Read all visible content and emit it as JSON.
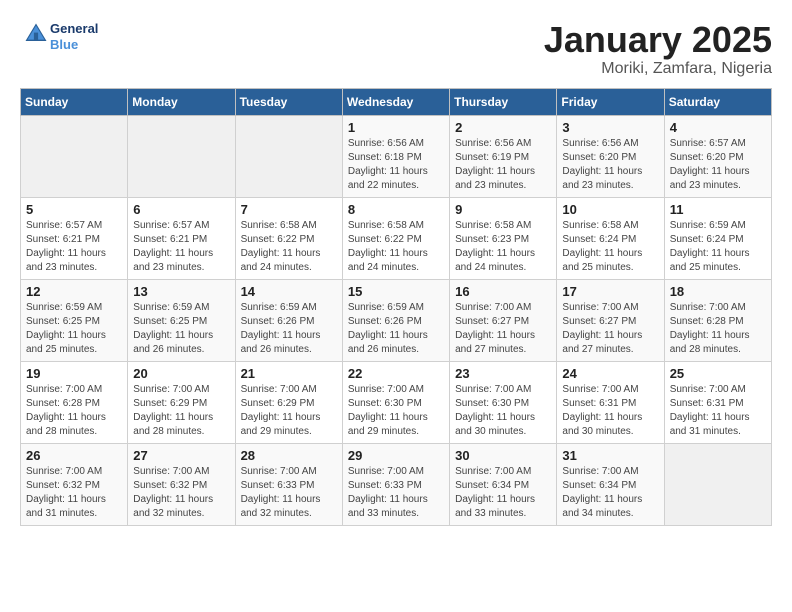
{
  "header": {
    "logo_general": "General",
    "logo_blue": "Blue",
    "title": "January 2025",
    "subtitle": "Moriki, Zamfara, Nigeria"
  },
  "weekdays": [
    "Sunday",
    "Monday",
    "Tuesday",
    "Wednesday",
    "Thursday",
    "Friday",
    "Saturday"
  ],
  "weeks": [
    [
      {
        "day": "",
        "sunrise": "",
        "sunset": "",
        "daylight": ""
      },
      {
        "day": "",
        "sunrise": "",
        "sunset": "",
        "daylight": ""
      },
      {
        "day": "",
        "sunrise": "",
        "sunset": "",
        "daylight": ""
      },
      {
        "day": "1",
        "sunrise": "Sunrise: 6:56 AM",
        "sunset": "Sunset: 6:18 PM",
        "daylight": "Daylight: 11 hours and 22 minutes."
      },
      {
        "day": "2",
        "sunrise": "Sunrise: 6:56 AM",
        "sunset": "Sunset: 6:19 PM",
        "daylight": "Daylight: 11 hours and 23 minutes."
      },
      {
        "day": "3",
        "sunrise": "Sunrise: 6:56 AM",
        "sunset": "Sunset: 6:20 PM",
        "daylight": "Daylight: 11 hours and 23 minutes."
      },
      {
        "day": "4",
        "sunrise": "Sunrise: 6:57 AM",
        "sunset": "Sunset: 6:20 PM",
        "daylight": "Daylight: 11 hours and 23 minutes."
      }
    ],
    [
      {
        "day": "5",
        "sunrise": "Sunrise: 6:57 AM",
        "sunset": "Sunset: 6:21 PM",
        "daylight": "Daylight: 11 hours and 23 minutes."
      },
      {
        "day": "6",
        "sunrise": "Sunrise: 6:57 AM",
        "sunset": "Sunset: 6:21 PM",
        "daylight": "Daylight: 11 hours and 23 minutes."
      },
      {
        "day": "7",
        "sunrise": "Sunrise: 6:58 AM",
        "sunset": "Sunset: 6:22 PM",
        "daylight": "Daylight: 11 hours and 24 minutes."
      },
      {
        "day": "8",
        "sunrise": "Sunrise: 6:58 AM",
        "sunset": "Sunset: 6:22 PM",
        "daylight": "Daylight: 11 hours and 24 minutes."
      },
      {
        "day": "9",
        "sunrise": "Sunrise: 6:58 AM",
        "sunset": "Sunset: 6:23 PM",
        "daylight": "Daylight: 11 hours and 24 minutes."
      },
      {
        "day": "10",
        "sunrise": "Sunrise: 6:58 AM",
        "sunset": "Sunset: 6:24 PM",
        "daylight": "Daylight: 11 hours and 25 minutes."
      },
      {
        "day": "11",
        "sunrise": "Sunrise: 6:59 AM",
        "sunset": "Sunset: 6:24 PM",
        "daylight": "Daylight: 11 hours and 25 minutes."
      }
    ],
    [
      {
        "day": "12",
        "sunrise": "Sunrise: 6:59 AM",
        "sunset": "Sunset: 6:25 PM",
        "daylight": "Daylight: 11 hours and 25 minutes."
      },
      {
        "day": "13",
        "sunrise": "Sunrise: 6:59 AM",
        "sunset": "Sunset: 6:25 PM",
        "daylight": "Daylight: 11 hours and 26 minutes."
      },
      {
        "day": "14",
        "sunrise": "Sunrise: 6:59 AM",
        "sunset": "Sunset: 6:26 PM",
        "daylight": "Daylight: 11 hours and 26 minutes."
      },
      {
        "day": "15",
        "sunrise": "Sunrise: 6:59 AM",
        "sunset": "Sunset: 6:26 PM",
        "daylight": "Daylight: 11 hours and 26 minutes."
      },
      {
        "day": "16",
        "sunrise": "Sunrise: 7:00 AM",
        "sunset": "Sunset: 6:27 PM",
        "daylight": "Daylight: 11 hours and 27 minutes."
      },
      {
        "day": "17",
        "sunrise": "Sunrise: 7:00 AM",
        "sunset": "Sunset: 6:27 PM",
        "daylight": "Daylight: 11 hours and 27 minutes."
      },
      {
        "day": "18",
        "sunrise": "Sunrise: 7:00 AM",
        "sunset": "Sunset: 6:28 PM",
        "daylight": "Daylight: 11 hours and 28 minutes."
      }
    ],
    [
      {
        "day": "19",
        "sunrise": "Sunrise: 7:00 AM",
        "sunset": "Sunset: 6:28 PM",
        "daylight": "Daylight: 11 hours and 28 minutes."
      },
      {
        "day": "20",
        "sunrise": "Sunrise: 7:00 AM",
        "sunset": "Sunset: 6:29 PM",
        "daylight": "Daylight: 11 hours and 28 minutes."
      },
      {
        "day": "21",
        "sunrise": "Sunrise: 7:00 AM",
        "sunset": "Sunset: 6:29 PM",
        "daylight": "Daylight: 11 hours and 29 minutes."
      },
      {
        "day": "22",
        "sunrise": "Sunrise: 7:00 AM",
        "sunset": "Sunset: 6:30 PM",
        "daylight": "Daylight: 11 hours and 29 minutes."
      },
      {
        "day": "23",
        "sunrise": "Sunrise: 7:00 AM",
        "sunset": "Sunset: 6:30 PM",
        "daylight": "Daylight: 11 hours and 30 minutes."
      },
      {
        "day": "24",
        "sunrise": "Sunrise: 7:00 AM",
        "sunset": "Sunset: 6:31 PM",
        "daylight": "Daylight: 11 hours and 30 minutes."
      },
      {
        "day": "25",
        "sunrise": "Sunrise: 7:00 AM",
        "sunset": "Sunset: 6:31 PM",
        "daylight": "Daylight: 11 hours and 31 minutes."
      }
    ],
    [
      {
        "day": "26",
        "sunrise": "Sunrise: 7:00 AM",
        "sunset": "Sunset: 6:32 PM",
        "daylight": "Daylight: 11 hours and 31 minutes."
      },
      {
        "day": "27",
        "sunrise": "Sunrise: 7:00 AM",
        "sunset": "Sunset: 6:32 PM",
        "daylight": "Daylight: 11 hours and 32 minutes."
      },
      {
        "day": "28",
        "sunrise": "Sunrise: 7:00 AM",
        "sunset": "Sunset: 6:33 PM",
        "daylight": "Daylight: 11 hours and 32 minutes."
      },
      {
        "day": "29",
        "sunrise": "Sunrise: 7:00 AM",
        "sunset": "Sunset: 6:33 PM",
        "daylight": "Daylight: 11 hours and 33 minutes."
      },
      {
        "day": "30",
        "sunrise": "Sunrise: 7:00 AM",
        "sunset": "Sunset: 6:34 PM",
        "daylight": "Daylight: 11 hours and 33 minutes."
      },
      {
        "day": "31",
        "sunrise": "Sunrise: 7:00 AM",
        "sunset": "Sunset: 6:34 PM",
        "daylight": "Daylight: 11 hours and 34 minutes."
      },
      {
        "day": "",
        "sunrise": "",
        "sunset": "",
        "daylight": ""
      }
    ]
  ]
}
